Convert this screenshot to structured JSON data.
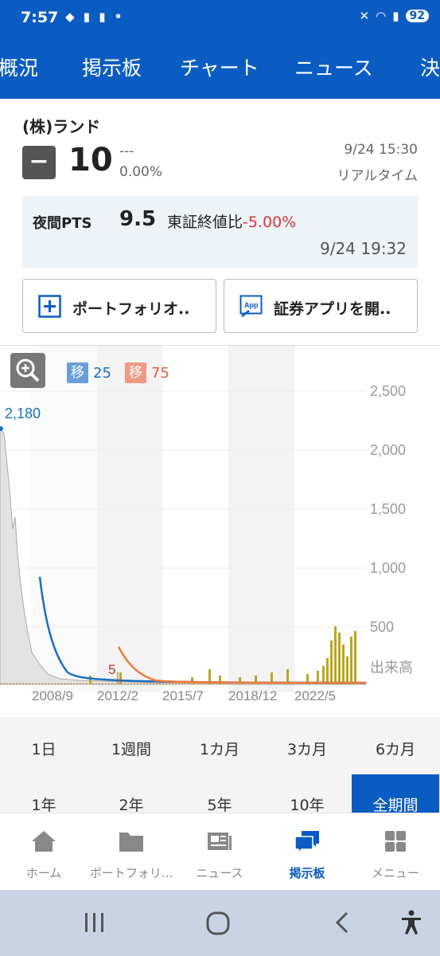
{
  "status_bar": {
    "time": "7:57",
    "battery": "92"
  },
  "tabs": [
    "概況",
    "掲示板",
    "チャート",
    "ニュース",
    "決"
  ],
  "stock": {
    "name": "(株)ランド",
    "price": "10",
    "change": "---",
    "change_pct": "0.00%",
    "date": "9/24 15:30",
    "mode": "リアルタイム"
  },
  "pts": {
    "label": "夜間PTS",
    "value": "9.5",
    "compare_label": "東証終値比",
    "compare_value": "-5.00%",
    "time": "9/24 19:32"
  },
  "buttons": {
    "portfolio": "ポートフォリオ..",
    "open_app": "証券アプリを開.."
  },
  "legend": {
    "ma1_symbol": "移",
    "ma1_value": "25",
    "ma2_symbol": "移",
    "ma2_value": "75",
    "ma1_color": "#1a6fc4",
    "ma2_color": "#f07a3a"
  },
  "chart_data": {
    "type": "line",
    "x_ticks": [
      "2008/9",
      "2012/2",
      "2015/7",
      "2018/12",
      "2022/5"
    ],
    "y_ticks": [
      "2,500",
      "2,000",
      "1,500",
      "1,000",
      "500"
    ],
    "ylim": [
      0,
      2500
    ],
    "volume_label": "出来高",
    "max_label": "2,180",
    "min_label": "5",
    "series": [
      {
        "name": "移 25",
        "color": "#1a6fc4"
      },
      {
        "name": "移 75",
        "color": "#f07a3a"
      }
    ]
  },
  "periods_row1": [
    "1日",
    "1週間",
    "1カ月",
    "3カ月",
    "6カ月"
  ],
  "periods_row2": [
    "1年",
    "2年",
    "5年",
    "10年",
    "全期間"
  ],
  "bottom_nav": [
    "ホーム",
    "ポートフォリ...",
    "ニュース",
    "掲示板",
    "メニュー"
  ]
}
